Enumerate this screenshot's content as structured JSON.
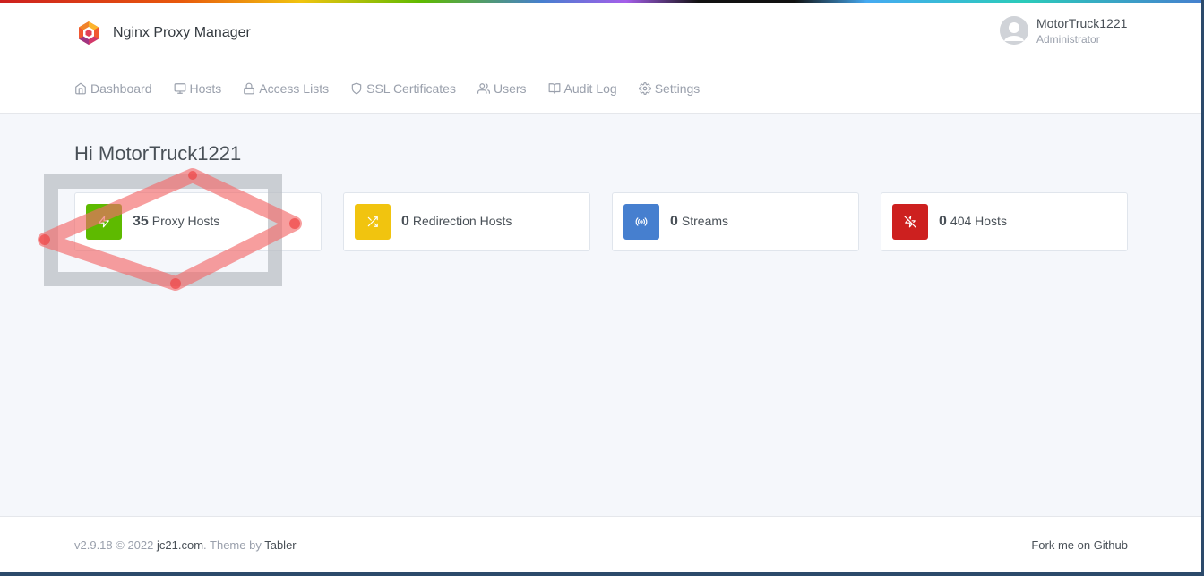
{
  "app": {
    "name": "Nginx Proxy Manager",
    "logo_icon": "nginx-proxy-manager-logo"
  },
  "user": {
    "name": "MotorTruck1221",
    "role": "Administrator"
  },
  "nav": {
    "items": [
      {
        "label": "Dashboard",
        "icon": "home-icon"
      },
      {
        "label": "Hosts",
        "icon": "monitor-icon"
      },
      {
        "label": "Access Lists",
        "icon": "lock-icon"
      },
      {
        "label": "SSL Certificates",
        "icon": "shield-icon"
      },
      {
        "label": "Users",
        "icon": "users-icon"
      },
      {
        "label": "Audit Log",
        "icon": "book-icon"
      },
      {
        "label": "Settings",
        "icon": "gear-icon"
      }
    ]
  },
  "main": {
    "greeting": "Hi MotorTruck1221",
    "cards": [
      {
        "count": "35",
        "label": "Proxy Hosts",
        "color": "#5eba00",
        "icon": "zap-icon"
      },
      {
        "count": "0",
        "label": "Redirection Hosts",
        "color": "#f1c40f",
        "icon": "shuffle-icon"
      },
      {
        "count": "0",
        "label": "Streams",
        "color": "#467fcf",
        "icon": "radio-icon"
      },
      {
        "count": "0",
        "label": "404 Hosts",
        "color": "#cd201f",
        "icon": "zap-off-icon"
      }
    ]
  },
  "footer": {
    "version": "v2.9.18 © 2022",
    "site_link": "jc21.com",
    "theme_prefix": ". Theme by",
    "theme_link": "Tabler",
    "github_link": "Fork me on Github"
  }
}
